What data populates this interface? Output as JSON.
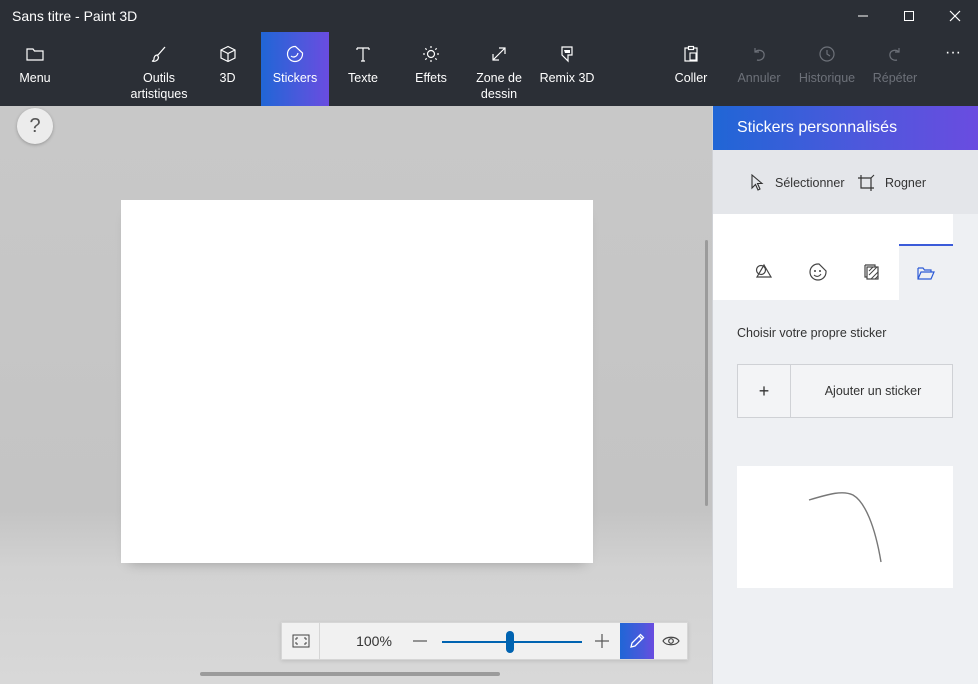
{
  "window": {
    "title": "Sans titre - Paint 3D"
  },
  "ribbon": {
    "menu": "Menu",
    "outils_line1": "Outils",
    "outils_line2": "artistiques",
    "three_d": "3D",
    "stickers": "Stickers",
    "texte": "Texte",
    "effets": "Effets",
    "zone_line1": "Zone de",
    "zone_line2": "dessin",
    "remix": "Remix 3D",
    "coller": "Coller",
    "annuler": "Annuler",
    "historique": "Historique",
    "repeter": "Répéter",
    "more": "···",
    "active_tab": "Stickers"
  },
  "workspace": {
    "help": "?"
  },
  "zoombar": {
    "value": "100%",
    "zoom_level": 100
  },
  "panel": {
    "title": "Stickers personnalisés",
    "select": "Sélectionner",
    "crop": "Rogner",
    "choose_label": "Choisir votre propre sticker",
    "add_plus": "+",
    "add_label": "Ajouter un sticker"
  },
  "icons": {
    "menu": "folder-icon",
    "outils": "brush-icon",
    "three_d": "cube-icon",
    "stickers": "sticker-icon",
    "texte": "text-icon",
    "effets": "sun-icon",
    "zone": "resize-icon",
    "remix": "remix-icon",
    "coller": "paste-icon",
    "annuler": "undo-icon",
    "historique": "history-icon",
    "repeter": "redo-icon"
  },
  "colors": {
    "accent_start": "#2066d6",
    "accent_end": "#6a4ce0",
    "chrome": "#2b2f36",
    "slider": "#0063b1"
  }
}
